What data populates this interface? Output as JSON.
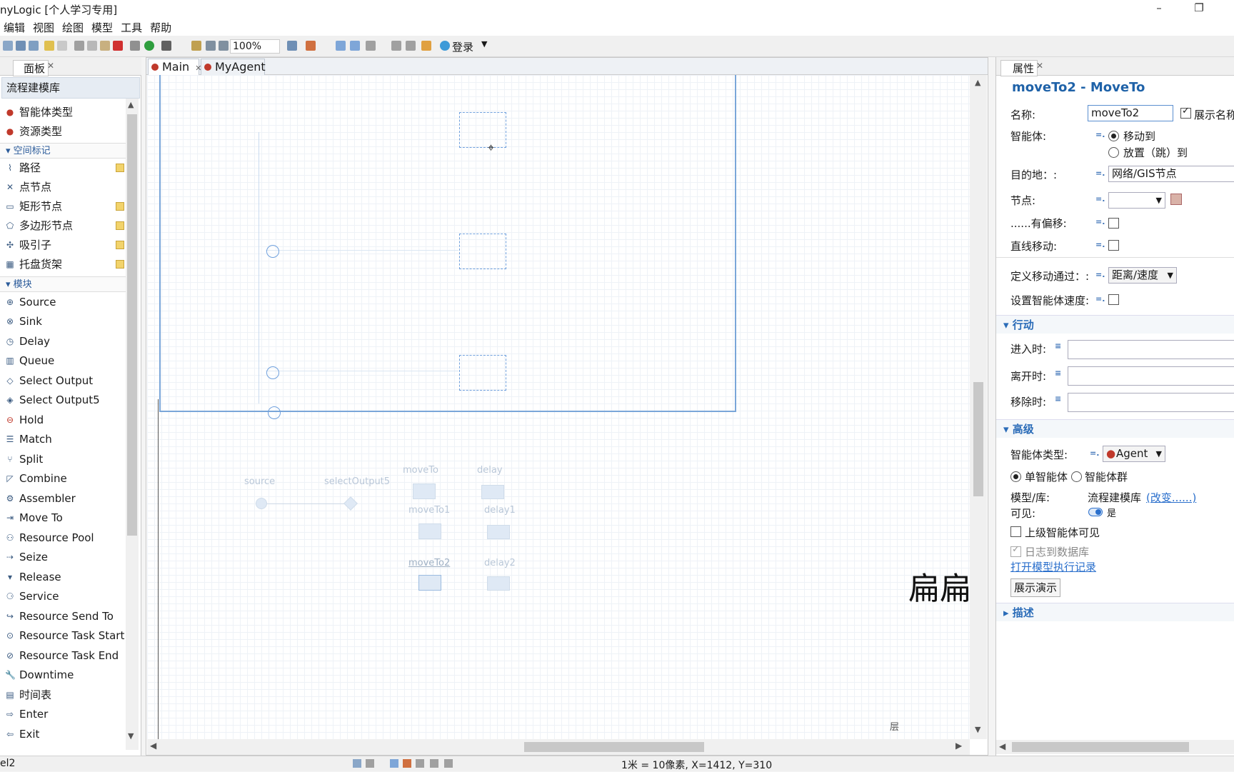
{
  "window": {
    "title": "nyLogic [个人学习专用]",
    "minimize": "–",
    "restore": "❐"
  },
  "menu": [
    "编辑",
    "视图",
    "绘图",
    "模型",
    "工具",
    "帮助"
  ],
  "toolbar": {
    "zoom": "100%",
    "login": "登录"
  },
  "left_panel": {
    "tabs": [
      "面板"
    ],
    "library": "流程建模库",
    "top_items": [
      {
        "label": "智能体类型",
        "icon": "agent-type-icon"
      },
      {
        "label": "资源类型",
        "icon": "resource-type-icon"
      }
    ],
    "section_space": "空间标记",
    "space_items": [
      {
        "label": "路径",
        "icon": "path-icon",
        "editable": true
      },
      {
        "label": "点节点",
        "icon": "point-node-icon",
        "editable": false
      },
      {
        "label": "矩形节点",
        "icon": "rect-node-icon",
        "editable": true
      },
      {
        "label": "多边形节点",
        "icon": "polygon-node-icon",
        "editable": true
      },
      {
        "label": "吸引子",
        "icon": "attractor-icon",
        "editable": true
      },
      {
        "label": "托盘货架",
        "icon": "pallet-rack-icon",
        "editable": true
      }
    ],
    "section_blocks": "模块",
    "block_items": [
      "Source",
      "Sink",
      "Delay",
      "Queue",
      "Select Output",
      "Select Output5",
      "Hold",
      "Match",
      "Split",
      "Combine",
      "Assembler",
      "Move To",
      "Resource Pool",
      "Seize",
      "Release",
      "Service",
      "Resource Send To",
      "Resource Task Start",
      "Resource Task End",
      "Downtime",
      "时间表",
      "Enter",
      "Exit"
    ]
  },
  "editor": {
    "tabs": [
      {
        "label": "Main",
        "active": true
      },
      {
        "label": "MyAgent",
        "active": false
      }
    ],
    "blocks": [
      "source",
      "selectOutput5",
      "moveTo",
      "delay",
      "moveTo1",
      "delay1",
      "moveTo2",
      "delay2"
    ],
    "layer_label": "层"
  },
  "properties": {
    "tab": "属性",
    "title": "moveTo2 - MoveTo",
    "name_label": "名称:",
    "name_value": "moveTo2",
    "show_name": "展示名称",
    "agent_label": "智能体:",
    "agent_opt1": "移动到",
    "agent_opt2": "放置（跳）到",
    "dest_label": "目的地：:",
    "dest_value": "网络/GIS节点",
    "node_label": "节点:",
    "offset_label": "......有偏移:",
    "straight_label": "直线移动:",
    "define_label": "定义移动通过：:",
    "define_value": "距离/速度",
    "speed_label": "设置智能体速度:",
    "section_actions": "行动",
    "on_enter": "进入时:",
    "on_exit": "离开时:",
    "on_remove": "移除时:",
    "section_advanced": "高级",
    "agent_type_label": "智能体类型:",
    "agent_type_value": "Agent",
    "single_agent": "单智能体",
    "agent_pop": "智能体群",
    "model_lib_label": "模型/库:",
    "model_lib_value": "流程建模库",
    "change_link": "(改变......)",
    "visible_label": "可见:",
    "visible_value": "是",
    "upper_visible": "上级智能体可见",
    "log_db": "日志到数据库",
    "open_log": "打开模型执行记录",
    "show_demo": "展示演示",
    "section_desc": "描述"
  },
  "overlay_text": "扁扁",
  "status": {
    "left": "el2",
    "scale": "1米 = 10像素, X=1412, Y=310"
  }
}
